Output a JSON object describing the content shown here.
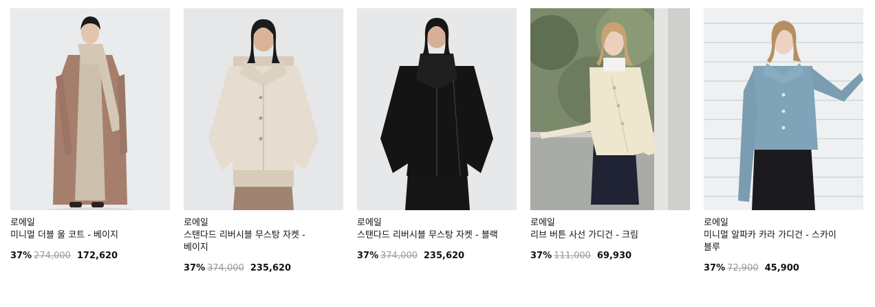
{
  "products": [
    {
      "brand": "로에일",
      "name": "미니멀 더블 울 코트 - 베이지",
      "discount": "37%",
      "original_price": "274,000",
      "sale_price": "172,620",
      "image_subject": "model-in-brown-long-coat",
      "colors": {
        "bg": "#e8eaeb",
        "garment": "#a57e6c",
        "inner": "#cdbfae"
      }
    },
    {
      "brand": "로에일",
      "name": "스탠다드 리버시블 무스탕 자켓 - 베이지",
      "discount": "37%",
      "original_price": "374,000",
      "sale_price": "235,620",
      "image_subject": "model-in-beige-shearling-jacket",
      "colors": {
        "bg": "#e6e7e8",
        "garment": "#e6dccf",
        "inner": "#a08370"
      }
    },
    {
      "brand": "로에일",
      "name": "스탠다드 리버시블 무스탕 자켓 - 블랙",
      "discount": "37%",
      "original_price": "374,000",
      "sale_price": "235,620",
      "image_subject": "model-in-black-shearling-jacket",
      "colors": {
        "bg": "#e7e8e9",
        "garment": "#141414",
        "inner": "#1f1f1f"
      }
    },
    {
      "brand": "로에일",
      "name": "리브 버튼 사선 가디건 - 크림",
      "discount": "37%",
      "original_price": "111,000",
      "sale_price": "69,930",
      "image_subject": "model-in-cream-cardigan-by-window",
      "colors": {
        "bg": "#b9bdb8",
        "garment": "#eee6cf",
        "inner": "#1f2333"
      }
    },
    {
      "brand": "로에일",
      "name": "미니멀 알파카 카라 가디건 - 스카이 블루",
      "discount": "37%",
      "original_price": "72,900",
      "sale_price": "45,900",
      "image_subject": "model-in-sky-blue-cardigan",
      "colors": {
        "bg": "#eef0f1",
        "garment": "#7fa3b8",
        "inner": "#1b1b1f"
      }
    }
  ]
}
